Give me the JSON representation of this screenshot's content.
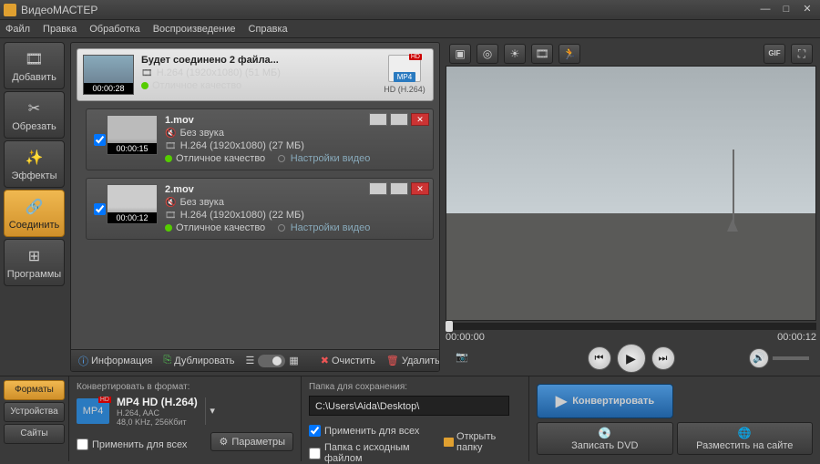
{
  "title": "ВидеоМАСТЕР",
  "menu": [
    "Файл",
    "Правка",
    "Обработка",
    "Воспроизведение",
    "Справка"
  ],
  "sidebar": [
    {
      "label": "Добавить",
      "icon": "🎞"
    },
    {
      "label": "Обрезать",
      "icon": "✂"
    },
    {
      "label": "Эффекты",
      "icon": "✨"
    },
    {
      "label": "Соединить",
      "icon": "🔗",
      "active": true
    },
    {
      "label": "Программы",
      "icon": "⊞"
    }
  ],
  "mergecard": {
    "title": "Будет соединено 2 файла...",
    "codec": "H.264 (1920x1080) (51 МБ)",
    "quality": "Отличное качество",
    "duration": "00:00:28",
    "format": "MP4",
    "formatDesc": "HD (H.264)",
    "hd": "HD"
  },
  "files": [
    {
      "name": "1.mov",
      "audio": "Без звука",
      "codec": "H.264 (1920x1080) (27 МБ)",
      "quality": "Отличное качество",
      "settings": "Настройки видео",
      "duration": "00:00:15"
    },
    {
      "name": "2.mov",
      "audio": "Без звука",
      "codec": "H.264 (1920x1080) (22 МБ)",
      "quality": "Отличное качество",
      "settings": "Настройки видео",
      "duration": "00:00:12"
    }
  ],
  "toolbar": {
    "info": "Информация",
    "dup": "Дублировать",
    "clear": "Очистить",
    "del": "Удалить"
  },
  "preview": {
    "gif": "GIF",
    "time_start": "00:00:00",
    "time_end": "00:00:12"
  },
  "bottom": {
    "tabs": [
      "Форматы",
      "Устройства",
      "Сайты"
    ],
    "convertTo": "Конвертировать в формат:",
    "format": {
      "name": "MP4 HD (H.264)",
      "detail": "H.264, AAC\n48,0 KHz, 256Кбит",
      "hd": "HD",
      "badge": "MP4"
    },
    "applyAll": "Применить для всех",
    "params": "Параметры",
    "saveFolder": "Папка для сохранения:",
    "path": "C:\\Users\\Aida\\Desktop\\",
    "copySource": "Папка с исходным файлом",
    "openFolder": "Открыть папку",
    "convert": "Конвертировать",
    "burnDvd": "Записать DVD",
    "publish": "Разместить на сайте"
  }
}
